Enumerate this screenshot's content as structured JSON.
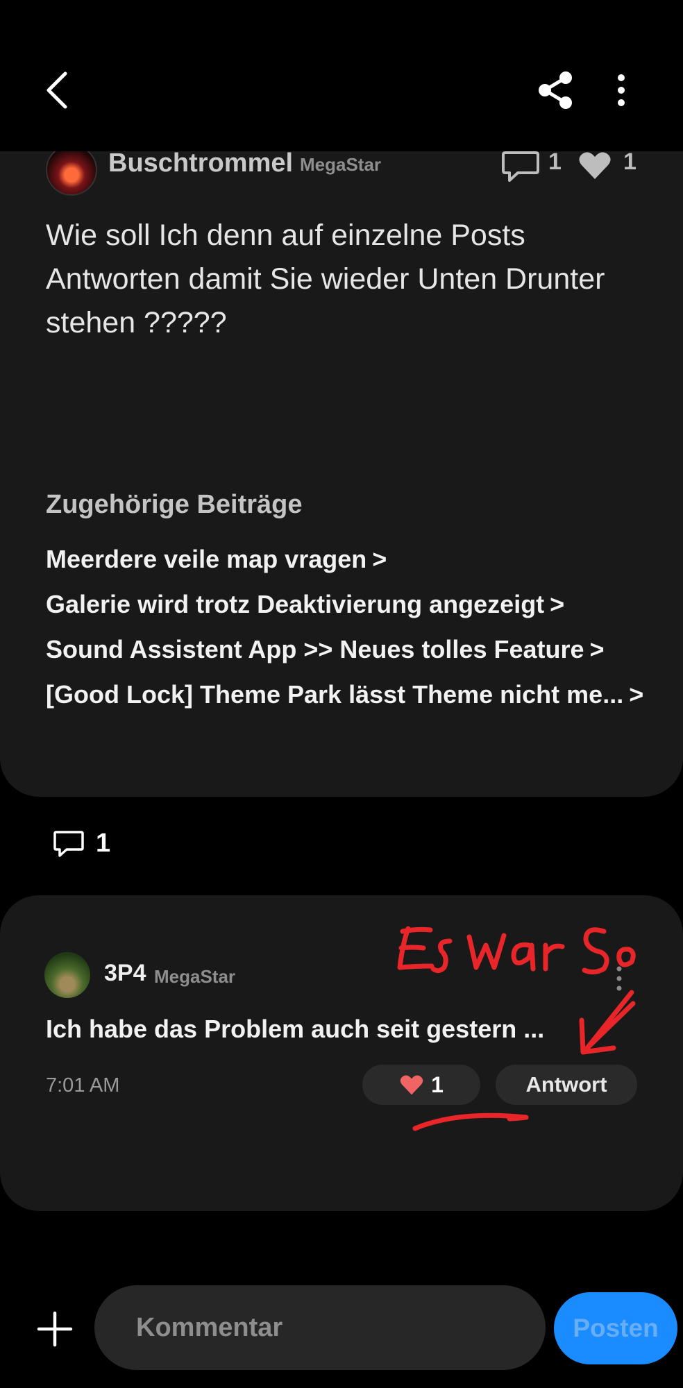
{
  "post": {
    "author": "Buschtrommel",
    "author_rank": "MegaStar",
    "comment_count": "1",
    "like_count": "1",
    "body": "Wie soll Ich denn auf einzelne Posts Antworten damit Sie wieder Unten Drunter stehen ?????"
  },
  "related": {
    "title": "Zugehörige Beiträge",
    "chevron": ">",
    "items": [
      {
        "label": "Meerdere veile map vragen"
      },
      {
        "label": "Galerie wird trotz Deaktivierung angezeigt"
      },
      {
        "label": "Sound Assistent App >> Neues tolles Feature"
      },
      {
        "label": "[Good Lock] Theme Park lässt Theme nicht me..."
      }
    ]
  },
  "comments_section": {
    "count": "1"
  },
  "comment": {
    "author": "3P4",
    "author_rank": "MegaStar",
    "text": "Ich habe das Problem auch seit gestern ...",
    "time": "7:01 AM",
    "like_count": "1",
    "reply_label": "Antwort"
  },
  "annotation": {
    "handwritten_text": "Es war So",
    "color": "#e8262a"
  },
  "composer": {
    "placeholder": "Kommentar",
    "post_label": "Posten"
  },
  "colors": {
    "background": "#000000",
    "card": "#191919",
    "pill": "#2a2a2a",
    "accent_button": "#1b8cff",
    "heart": "#f06464"
  },
  "icons": {
    "back": "back-arrow-icon",
    "share": "share-icon",
    "more": "more-vertical-icon",
    "comment": "comment-bubble-icon",
    "like": "heart-icon",
    "add": "plus-icon"
  }
}
